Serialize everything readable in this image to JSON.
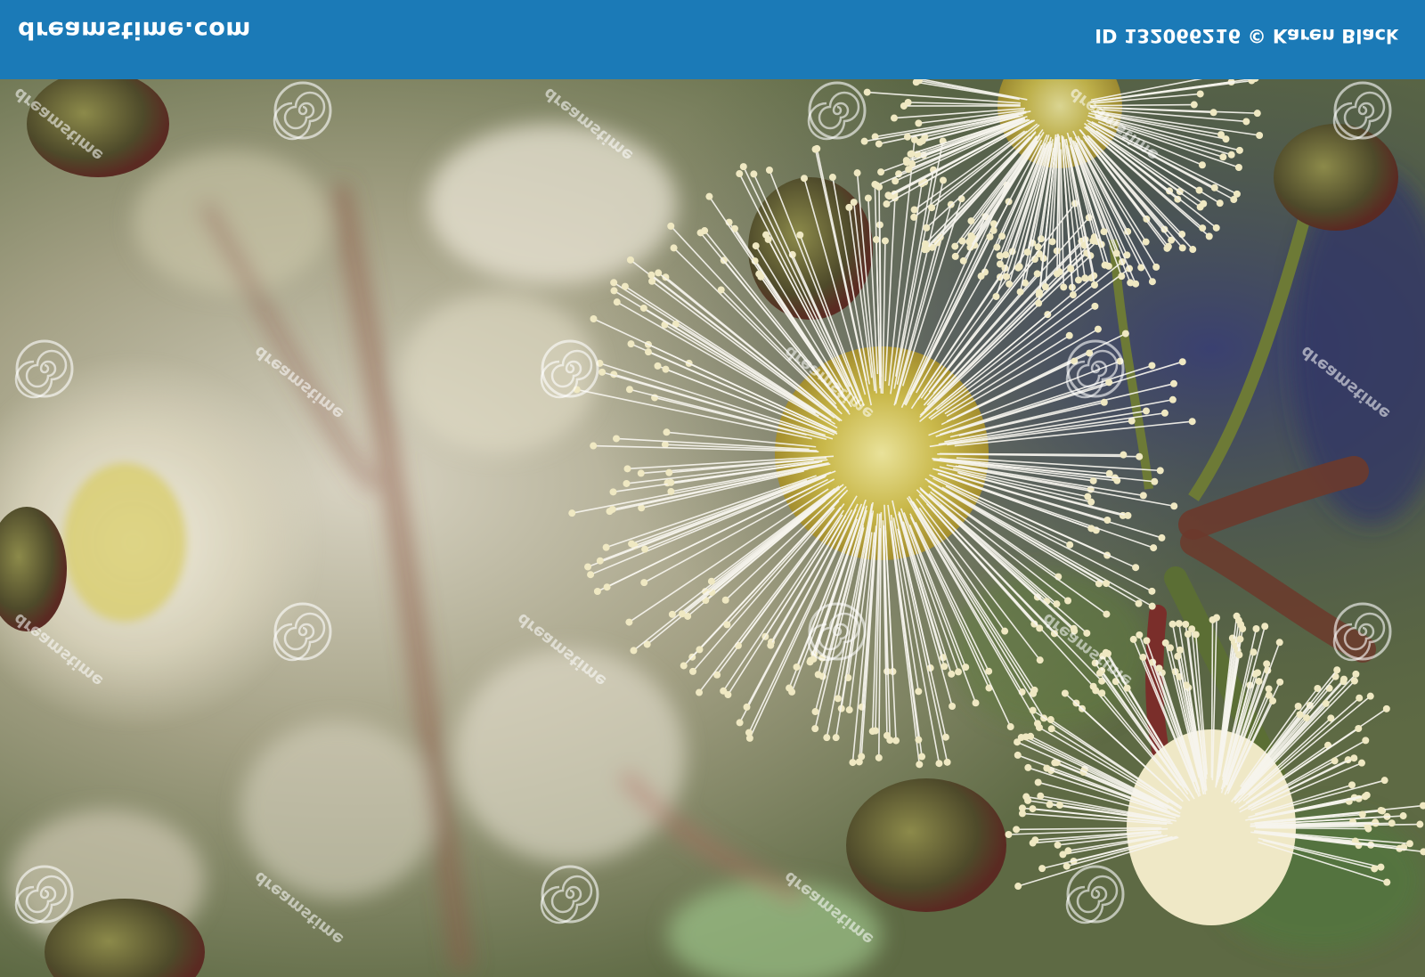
{
  "banner": {
    "brand": "dreamstime.com",
    "credit": "ID 132066216 © Karen Black",
    "color": "#1b7ab7"
  },
  "photo": {
    "subject": "white eucalyptus blossoms"
  },
  "watermark": {
    "text": "dreamstime"
  }
}
